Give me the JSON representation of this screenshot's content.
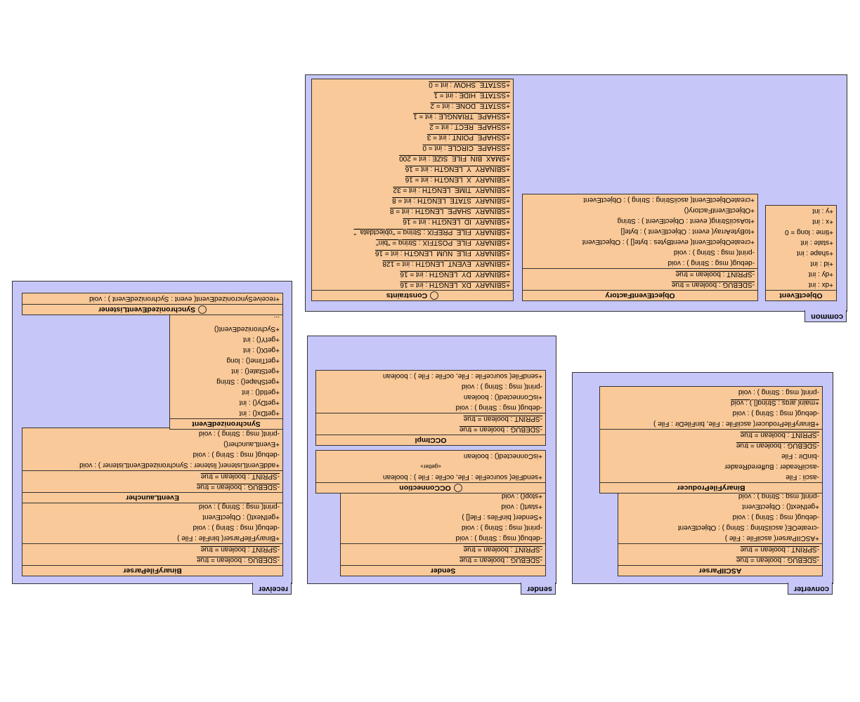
{
  "packages": {
    "receiver": {
      "title": "receiver"
    },
    "sender": {
      "title": "sender"
    },
    "converter": {
      "title": "converter"
    },
    "common": {
      "title": "common"
    }
  },
  "classes": {
    "BinaryFileParser": {
      "title": "BinaryFileParser",
      "attrs": [
        "-SDEBUG : boolean = true",
        "-SPRINT : boolean = true"
      ],
      "ops": [
        "+BinaryFileParser( binFile : File )",
        "-debug( msg : String ) : void",
        "+getNext() : ObjectEvent",
        "-print( msg : String ) : void"
      ]
    },
    "EventLauncher": {
      "title": "EventLauncher",
      "attrs": [
        "-SDEBUG : boolean = true",
        "-SPRINT : boolean = true"
      ],
      "ops": [
        "+addEventListener( listener : SynchronizedEventListener ) : void",
        "-debug( msg : String ) : void",
        "+EventLauncher()",
        "-print( msg : String ) : void"
      ]
    },
    "SynchronizedEvent": {
      "title": "SynchronizedEvent",
      "ops": [
        "+getDx() : int",
        "+getDy() : int",
        "+getId() : int",
        "+getShape() : String",
        "+getState() : int",
        "+getTime() : long",
        "+getX() : int",
        "+getY() : int",
        "+SychronizedEvent()",
        "..."
      ]
    },
    "SynchronizedEventListener": {
      "title": "SynchronizedEventListener",
      "iface": true,
      "ops": [
        "+receiveSyncronizedEvent( event : SychronizedEvent ) : void"
      ]
    },
    "Sender": {
      "title": "Sender",
      "attrs": [
        "-SDEBUG : boolean = true",
        "-SPRINT : boolean = true"
      ],
      "ops": [
        "-debug( msg : String ) : void",
        "-print( msg : String ) : void",
        "+Sender( binFiles : File[] )",
        "+start() : void",
        "+stop() : void"
      ]
    },
    "OCConnection": {
      "title": "OCConnection",
      "iface": true,
      "ops": [
        "+sendFile( sourceFile : File, ocFile : File ) : boolean",
        "+isConnected() : boolean"
      ],
      "stereo": "«getter»"
    },
    "OCCImpl": {
      "title": "OCCImpl",
      "attrs": [
        "-SDEBUG : boolean = true",
        "-SPRINT : boolean = true"
      ],
      "ops": [
        "-debug( msg : String ) : void",
        "+isConnected() : boolean",
        "-print( msg : String ) : void",
        "+sendFile( sourceFile : File, ocFile : File ) : boolean"
      ]
    },
    "ASCIIParser": {
      "title": "ASCIIParser",
      "attrs": [
        "-SDEBUG : boolean = true",
        "-SPRINT : boolean = true"
      ],
      "ops": [
        "+ASCIIParser( asciiFile : File )",
        "-createOE( asciiString : String ) : ObjectEvent",
        "-debug( msg : String ) : void",
        "+getNext() : ObjectEvent",
        "-print( msg : String ) : void"
      ]
    },
    "BinaryFileProducer": {
      "title": "BinaryFileProducer",
      "attrs": [
        "-ascii : File",
        "-asciiReader : BufferedReader",
        "-binDir : File",
        "-SDEBUG : boolean = true",
        "-SPRINT : boolean = true"
      ],
      "ops": [
        "+BinaryFileProducer( asciiFile : File, binFileDir : File )",
        "-debug( msg : String ) : void",
        "+main( args : String[] ) : void",
        "-print( msg : String ) : void"
      ]
    },
    "Constraints": {
      "title": "Constraints",
      "iface": true,
      "attrs": [
        "+SBINARY_DX_LENGTH : int = 16",
        "+SBINARY_DY_LENGTH : int = 16",
        "+SBINARY_EVENT_LENGTH : int = 128",
        "+SBINARY_FILE_NUM_LENGTH : int = 16",
        "+SBINARY_FILE_POSTFIX : String = \"bin\"",
        "+SBINARY_FILE_PREFIX : String = \"objectdata_\"",
        "+SBINARY_ID_LENGTH : int = 16",
        "+SBINARY_SHAPE_LENGTH : int = 8",
        "+SBINARY_STATE_LENGTH : int = 8",
        "+SBINARY_TIME_LENGTH : int = 32",
        "+SBINARY_X_LENGTH : int = 16",
        "+SBINARY_Y_LENGTH : int = 16",
        "+SMAX_BIN_FILE_SIZE : int = 200",
        "+SSHAPE_CIRCLE : int = 0",
        "+SSHAPE_POINT : int = 3",
        "+SSHAPE_RECT : int = 2",
        "+SSHAPE_TRIANGLE : int = 1",
        "+SSTATE_DONE : int = 2",
        "+SSTATE_HIDE : int = 1",
        "+SSTATE_SHOW : int = 0"
      ]
    },
    "ObjectEventFactory": {
      "title": "ObjectEventFactory",
      "attrs": [
        "-SDEBUG : boolean = true",
        "-SPRINT : boolean = true"
      ],
      "ops": [
        "-debug( msg : String ) : void",
        "-print( msg : String ) : void",
        "+createObjectEvent( eventBytes : byte[] ) : ObjectEvent",
        "+toByteArray( event : ObjectEvent ) : byte[]",
        "+toAsciiString( event : ObjectEvent ) : String",
        "+ObjectEventFactory()",
        "+createObjectEvent( asciiString : String ) : ObjectEvent"
      ]
    },
    "ObjectEvent": {
      "title": "ObjectEvent",
      "attrs": [
        "+dx : int",
        "+dy : int",
        "+id : int",
        "+shape : int",
        "+state : int",
        "+time : long = 0",
        "+x : int",
        "+y : int"
      ]
    }
  }
}
